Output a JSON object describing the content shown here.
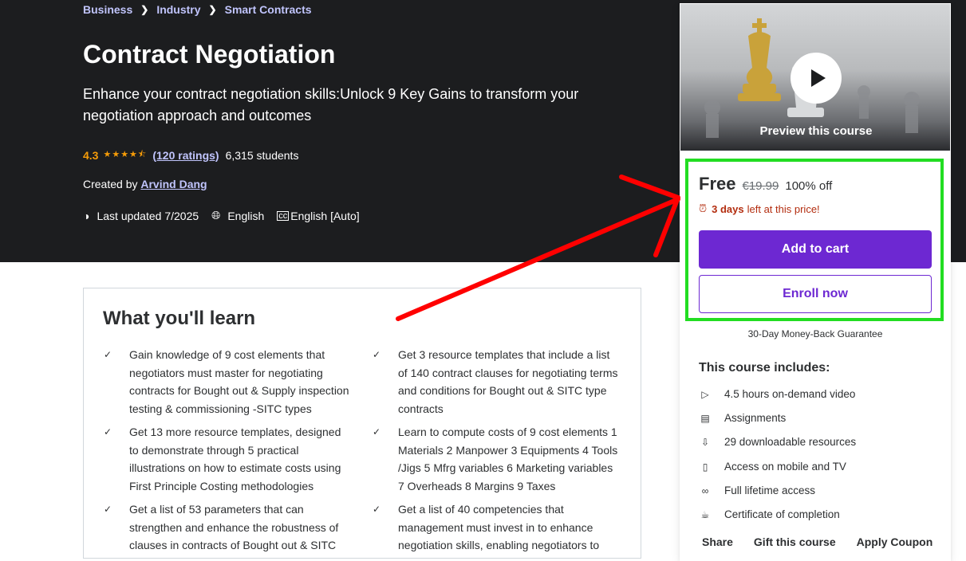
{
  "breadcrumb": [
    "Business",
    "Industry",
    "Smart Contracts"
  ],
  "course": {
    "title": "Contract Negotiation",
    "subtitle": "Enhance your contract negotiation skills:Unlock 9 Key Gains to transform your negotiation approach and outcomes",
    "rating": "4.3",
    "rating_value": 4.3,
    "ratings_count": "(120 ratings)",
    "students": "6,315 students",
    "created_by_label": "Created by",
    "author": "Arvind Dang",
    "last_updated": "Last updated 7/2025",
    "language": "English",
    "captions": "English [Auto]"
  },
  "learn": {
    "title": "What you'll learn",
    "items": [
      "Gain knowledge of 9 cost elements that negotiators must master for negotiating contracts for Bought out & Supply inspection testing & commissioning -SITC types",
      "Get 3 resource templates that include a list of 140 contract clauses for negotiating terms and conditions for Bought out & SITC type contracts",
      "Get 13 more resource templates, designed to demonstrate through 5 practical illustrations on how to estimate costs using First Principle Costing methodologies",
      "Learn to compute costs of 9 cost elements 1 Materials 2 Manpower 3 Equipments 4 Tools /Jigs 5 Mfrg variables 6 Marketing variables 7 Overheads 8 Margins 9 Taxes",
      "Get a list of 53 parameters that can strengthen and enhance the robustness of clauses in contracts of Bought out & SITC",
      "Get a list of 40 competencies that management must invest in to enhance negotiation skills, enabling negotiators to"
    ]
  },
  "sidebar": {
    "preview_label": "Preview this course",
    "price": "Free",
    "original_price": "€19.99",
    "discount": "100% off",
    "timer_days": "3 days",
    "timer_text": "left at this price!",
    "add_to_cart": "Add to cart",
    "enroll_now": "Enroll now",
    "guarantee": "30-Day Money-Back Guarantee",
    "includes_title": "This course includes:",
    "includes": [
      {
        "icon": "video-icon",
        "label": "4.5 hours on-demand video"
      },
      {
        "icon": "assignment-icon",
        "label": "Assignments"
      },
      {
        "icon": "download-icon",
        "label": "29 downloadable resources"
      },
      {
        "icon": "mobile-icon",
        "label": "Access on mobile and TV"
      },
      {
        "icon": "infinity-icon",
        "label": "Full lifetime access"
      },
      {
        "icon": "trophy-icon",
        "label": "Certificate of completion"
      }
    ],
    "footer": [
      "Share",
      "Gift this course",
      "Apply Coupon"
    ]
  },
  "colors": {
    "hero_bg": "#1c1d1f",
    "link": "#c0c4fc",
    "star": "#f69c08",
    "primary": "#6d28d2",
    "timer": "#b32d0f",
    "annotation_green": "#22dd22",
    "annotation_red": "#ff0000"
  }
}
